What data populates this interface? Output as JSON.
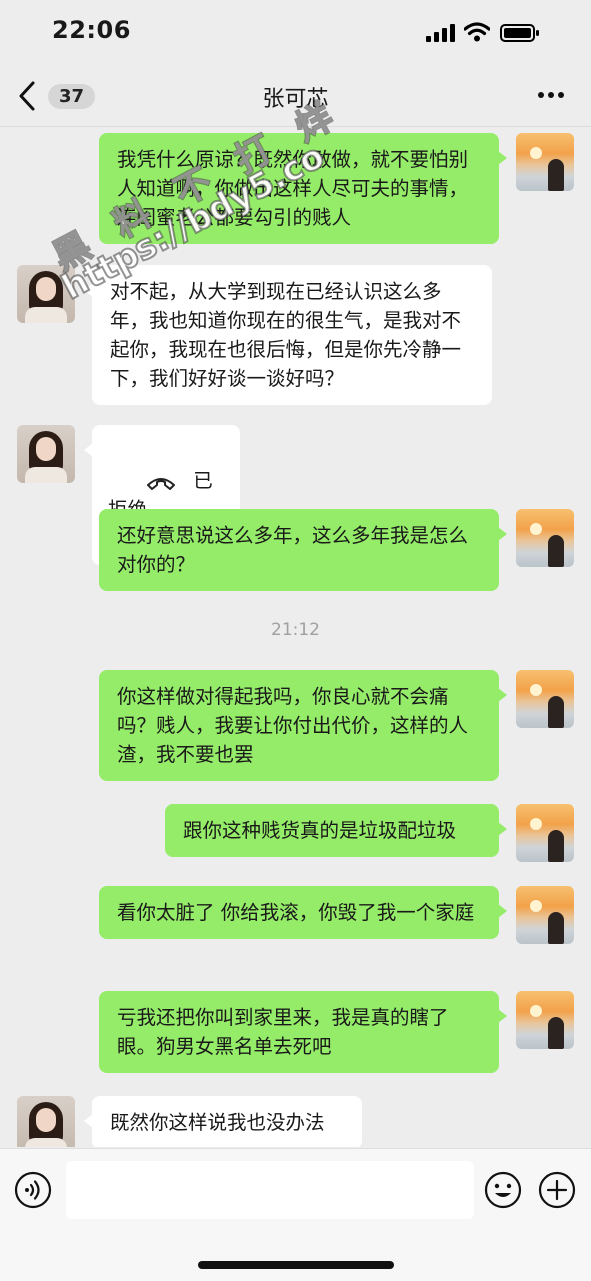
{
  "status_bar": {
    "time": "22:06",
    "signal_icon": "signal-icon",
    "wifi_icon": "wifi-icon",
    "battery_icon": "battery-icon"
  },
  "nav": {
    "back_icon": "chevron-left-icon",
    "unread_count": "37",
    "title": "张可芯",
    "more_icon": "more-dots-icon"
  },
  "watermark": {
    "line1": "黑 料 不 打 烊",
    "line2": "https://bdy5.co"
  },
  "messages": [
    {
      "from": "me",
      "text": "我凭什么原谅？既然你敢做，就不要怕别人知道啊，你做出这样人尽可夫的事情，连闺蜜老公都要勾引的贱人"
    },
    {
      "from": "her",
      "text": "对不起，从大学到现在已经认识这么多年，我也知道你现在的很生气，是我对不起你，我现在也很后悔，但是你先冷静一下，我们好好谈一谈好吗？"
    },
    {
      "from": "her",
      "type": "call",
      "icon": "phone-hangup-icon",
      "text": "已拒绝"
    },
    {
      "from": "me",
      "text": "还好意思说这么多年，这么多年我是怎么对你的？"
    },
    {
      "type": "time",
      "text": "21:12"
    },
    {
      "from": "me",
      "text": "你这样做对得起我吗，你良心就不会痛吗？贱人，我要让你付出代价，这样的人渣，我不要也罢"
    },
    {
      "from": "me",
      "text": "跟你这种贱货真的是垃圾配垃圾"
    },
    {
      "from": "me",
      "text": "看你太脏了 你给我滚，你毁了我一个家庭"
    },
    {
      "from": "me",
      "text": "亏我还把你叫到家里来，我是真的瞎了眼。狗男女黑名单去死吧"
    },
    {
      "from": "her",
      "text": "既然你这样说我也没办法"
    }
  ],
  "input_bar": {
    "voice_icon": "voice-icon",
    "input_value": "",
    "emoji_icon": "emoji-icon",
    "plus_icon": "plus-icon"
  },
  "colors": {
    "my_bubble": "#95ec69",
    "her_bubble": "#ffffff",
    "background": "#ededed"
  }
}
